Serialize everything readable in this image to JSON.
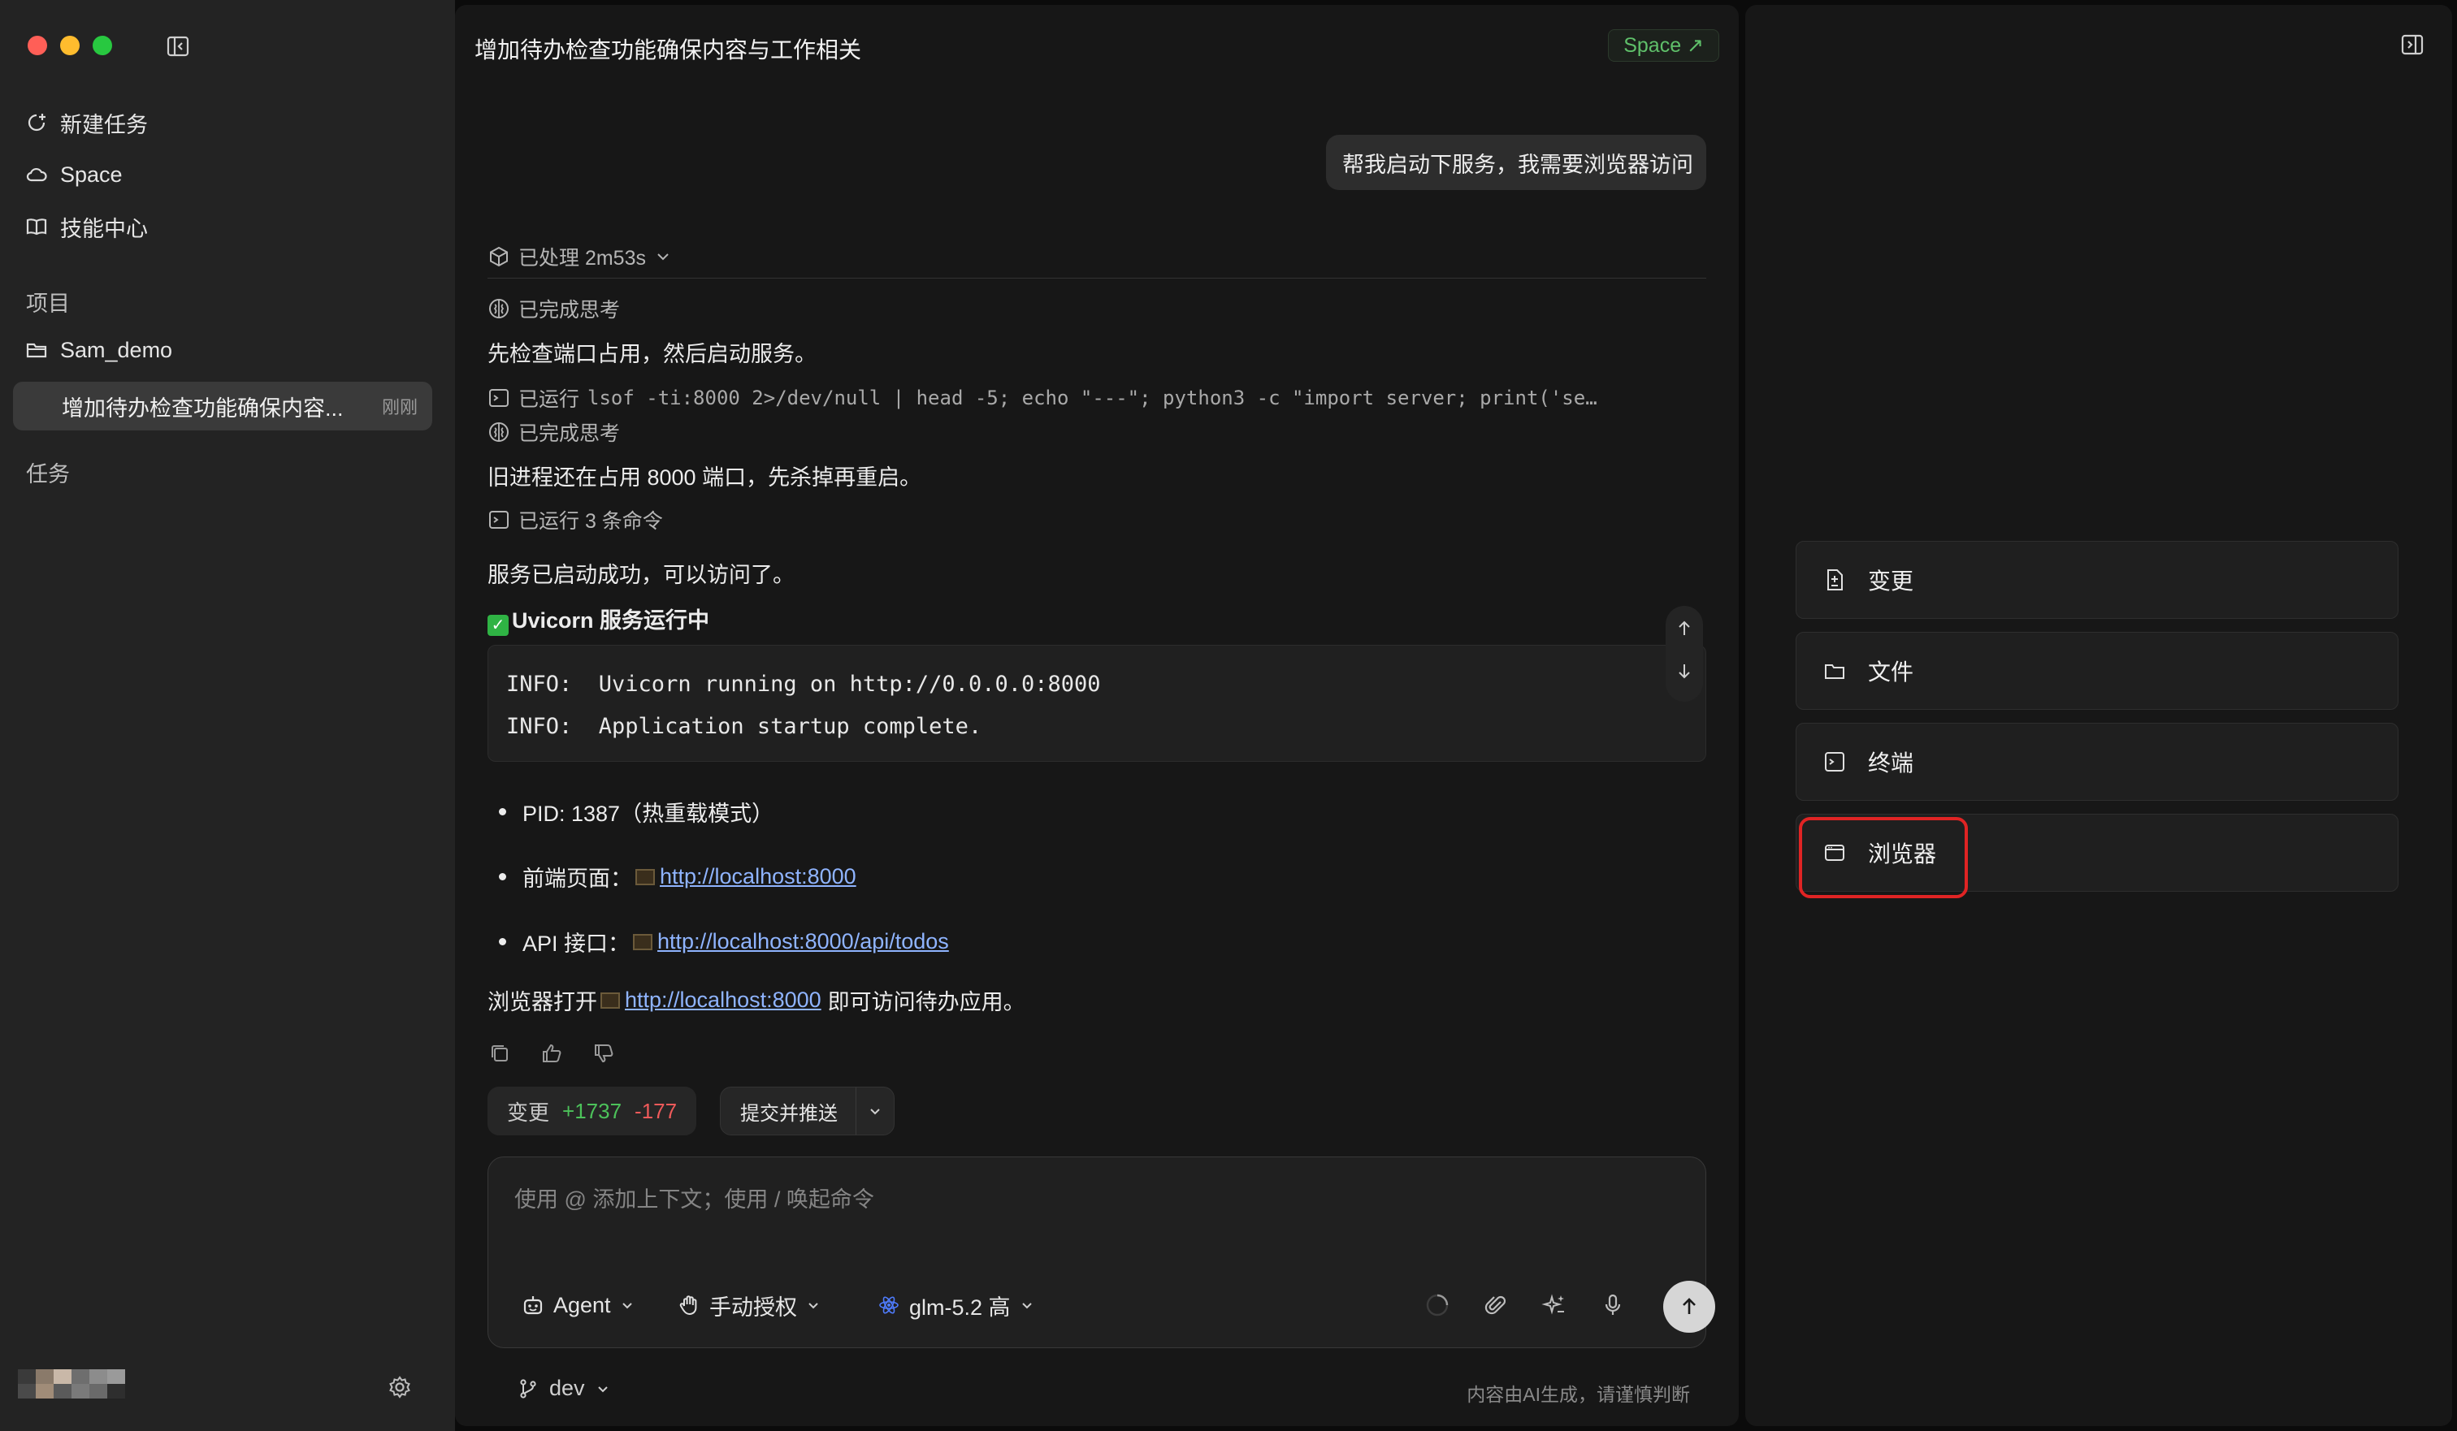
{
  "sidebar": {
    "nav": [
      {
        "label": "新建任务",
        "icon": "new-task-icon"
      },
      {
        "label": "Space",
        "icon": "cloud-icon"
      },
      {
        "label": "技能中心",
        "icon": "book-icon"
      }
    ],
    "projects_heading": "项目",
    "project_name": "Sam_demo",
    "active_task": {
      "title": "增加待办检查功能确保内容...",
      "time": "刚刚"
    },
    "tasks_heading": "任务"
  },
  "chat": {
    "title": "增加待办检查功能确保内容与工作相关",
    "space_badge": "Space ↗",
    "user_message": "帮我启动下服务，我需要浏览器访问",
    "processed": "已处理 2m53s",
    "steps": {
      "think1": "已完成思考",
      "text1": "先检查端口占用，然后启动服务。",
      "run1_label": "已运行",
      "run1_cmd": "lsof -ti:8000 2>/dev/null | head -5; echo \"---\"; python3 -c \"import server; print('se…",
      "think2": "已完成思考",
      "text2": "旧进程还在占用 8000 端口，先杀掉再重启。",
      "run2": "已运行 3 条命令"
    },
    "result_text": "服务已启动成功，可以访问了。",
    "status_heading": "Uvicorn 服务运行中",
    "code_lines": [
      "INFO:  Uvicorn running on http://0.0.0.0:8000",
      "INFO:  Application startup complete."
    ],
    "bullets": {
      "pid": "PID: 1387（热重载模式）",
      "frontend_label": "前端页面：",
      "frontend_url": "http://localhost:8000",
      "api_label": "API 接口：",
      "api_url": "http://localhost:8000/api/todos"
    },
    "final": {
      "prefix": "浏览器打开",
      "url": "http://localhost:8000",
      "suffix": "即可访问待办应用。"
    },
    "changes": {
      "label": "变更",
      "added": "+1737",
      "removed": "-177"
    },
    "commit_label": "提交并推送"
  },
  "input": {
    "placeholder": "使用 @ 添加上下文；使用 / 唤起命令",
    "agent": "Agent",
    "permission": "手动授权",
    "model": "glm-5.2 高"
  },
  "footer": {
    "branch": "dev",
    "disclaimer": "内容由AI生成，请谨慎判断"
  },
  "right_panel": {
    "items": [
      {
        "label": "变更",
        "icon": "diff-file-icon"
      },
      {
        "label": "文件",
        "icon": "folder-icon"
      },
      {
        "label": "终端",
        "icon": "terminal-icon"
      },
      {
        "label": "浏览器",
        "icon": "browser-icon",
        "highlighted": true
      }
    ]
  },
  "colors": {
    "accent_green": "#4cc25a",
    "deletion_red": "#ef5a5a",
    "link_blue": "#8fb4ff",
    "highlight_red": "#e02424"
  }
}
